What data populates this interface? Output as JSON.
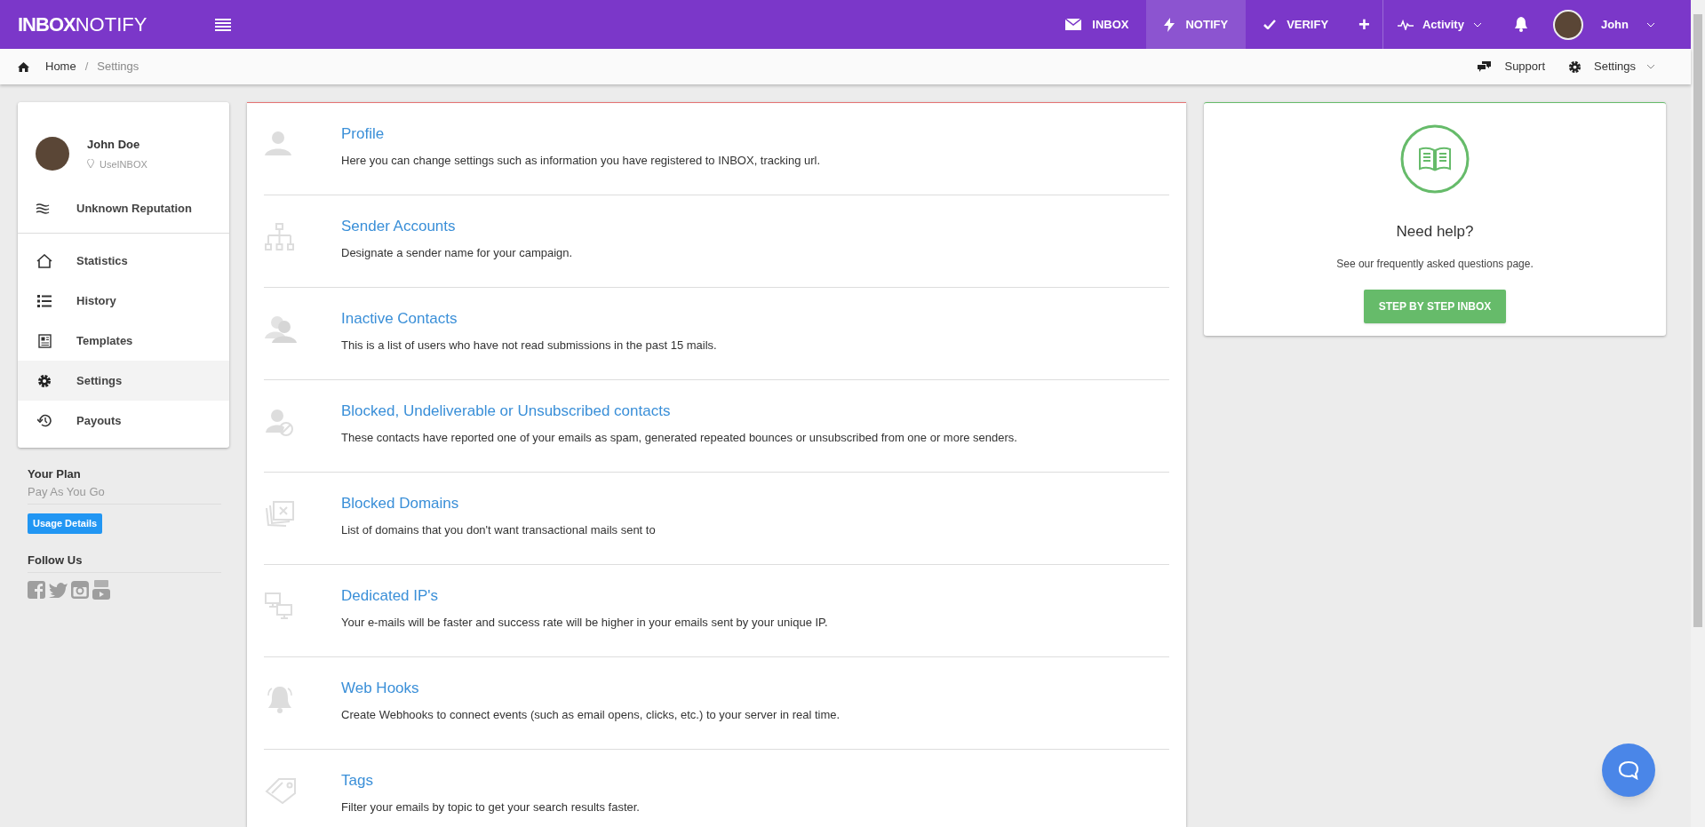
{
  "topbar": {
    "logo_bold": "INBOX",
    "logo_light": "NOTIFY",
    "nav_items": [
      {
        "kind": "mail",
        "label": "INBOX",
        "selected": false
      },
      {
        "kind": "bolt",
        "label": "NOTIFY",
        "selected": true
      },
      {
        "kind": "check",
        "label": "VERIFY",
        "selected": false
      }
    ],
    "add_button": "+",
    "activity": "Activity",
    "user": "John"
  },
  "breadcrumb": {
    "separator": "/",
    "items": [
      {
        "label": "Home",
        "selected": false
      },
      {
        "label": "Settings",
        "selected": true
      }
    ],
    "support": "Support",
    "settings": "Settings"
  },
  "sidebar": {
    "profile": {
      "name": "John Doe",
      "location": "UseINBOX"
    },
    "reputation": "Unknown Reputation",
    "items": [
      {
        "kind": "home",
        "label": "Statistics",
        "selected": false
      },
      {
        "kind": "list",
        "label": "History",
        "selected": false
      },
      {
        "kind": "template",
        "label": "Templates",
        "selected": false
      },
      {
        "kind": "gear",
        "label": "Settings",
        "selected": true
      },
      {
        "kind": "history",
        "label": "Payouts",
        "selected": false
      }
    ],
    "plan_title": "Your Plan",
    "plan": "Pay As You Go",
    "usage_button": "Usage Details",
    "follow_title": "Follow Us",
    "social": [
      {
        "kind": "facebook"
      },
      {
        "kind": "twitter"
      },
      {
        "kind": "instagram"
      },
      {
        "kind": "youtube"
      }
    ]
  },
  "settings_rows": [
    {
      "kind": "user",
      "title": "Profile",
      "description": "Here you can change settings such as information you have registered to INBOX, tracking url."
    },
    {
      "kind": "tree",
      "title": "Sender Accounts",
      "description": "Designate a sender name for your campaign."
    },
    {
      "kind": "users",
      "title": "Inactive Contacts",
      "description": "This is a list of users who have not read submissions in the past 15 mails."
    },
    {
      "kind": "blocked",
      "title": "Blocked, Undeliverable or Unsubscribed contacts",
      "description": "These contacts have reported one of your emails as spam, generated repeated bounces or unsubscribed from one or more senders."
    },
    {
      "kind": "cards",
      "title": "Blocked Domains",
      "description": "List of domains that you don't want transactional mails sent to"
    },
    {
      "kind": "screens",
      "title": "Dedicated IP's",
      "description": "Your e-mails will be faster and success rate will be higher in your emails sent by your unique IP."
    },
    {
      "kind": "bell",
      "title": "Web Hooks",
      "description": "Create Webhooks to connect events (such as email opens, clicks, etc.) to your server in real time."
    },
    {
      "kind": "tag",
      "title": "Tags",
      "description": "Filter your emails by topic to get your search results faster."
    }
  ],
  "help": {
    "title": "Need help?",
    "text": "See our frequently asked questions page.",
    "button": "STEP BY STEP INBOX"
  }
}
